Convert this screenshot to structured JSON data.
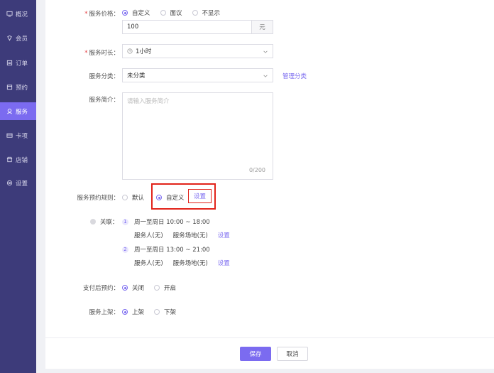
{
  "sidebar": {
    "items": [
      {
        "label": "概况",
        "icon": "monitor-icon"
      },
      {
        "label": "会员",
        "icon": "diamond-icon"
      },
      {
        "label": "订单",
        "icon": "list-icon"
      },
      {
        "label": "预约",
        "icon": "calendar-icon"
      },
      {
        "label": "服务",
        "icon": "service-icon",
        "active": true
      },
      {
        "label": "卡项",
        "icon": "card-icon"
      },
      {
        "label": "店铺",
        "icon": "store-icon"
      },
      {
        "label": "设置",
        "icon": "gear-icon"
      }
    ]
  },
  "form": {
    "price": {
      "label": "服务价格：",
      "options": [
        "自定义",
        "面议",
        "不显示"
      ],
      "value": "100",
      "unit": "元"
    },
    "duration": {
      "label": "服务时长：",
      "value": "1小时"
    },
    "category": {
      "label": "服务分类：",
      "value": "未分类",
      "manage_link": "管理分类"
    },
    "intro": {
      "label": "服务简介：",
      "placeholder": "请输入服务简介",
      "counter": "0/200"
    },
    "rule": {
      "label": "服务预约规则：",
      "options": [
        "默认",
        "自定义"
      ],
      "setting_link": "设置"
    },
    "relation": {
      "label": "关联：",
      "items": [
        {
          "num": "1",
          "time": "周一至周日 10:00 ~ 18:00",
          "staff": "服务人(无)",
          "place": "服务场地(无)",
          "link": "设置"
        },
        {
          "num": "2",
          "time": "周一至周日 13:00 ~ 21:00",
          "staff": "服务人(无)",
          "place": "服务场地(无)",
          "link": "设置"
        }
      ]
    },
    "after_pay": {
      "label": "支付后预约：",
      "options": [
        "关闭",
        "开启"
      ]
    },
    "shelf": {
      "label": "服务上架：",
      "options": [
        "上架",
        "下架"
      ]
    }
  },
  "footer": {
    "save": "保存",
    "cancel": "取消"
  },
  "colors": {
    "accent": "#7b6bf0",
    "sidebar": "#3d3b7a",
    "highlight": "#e2231a"
  }
}
